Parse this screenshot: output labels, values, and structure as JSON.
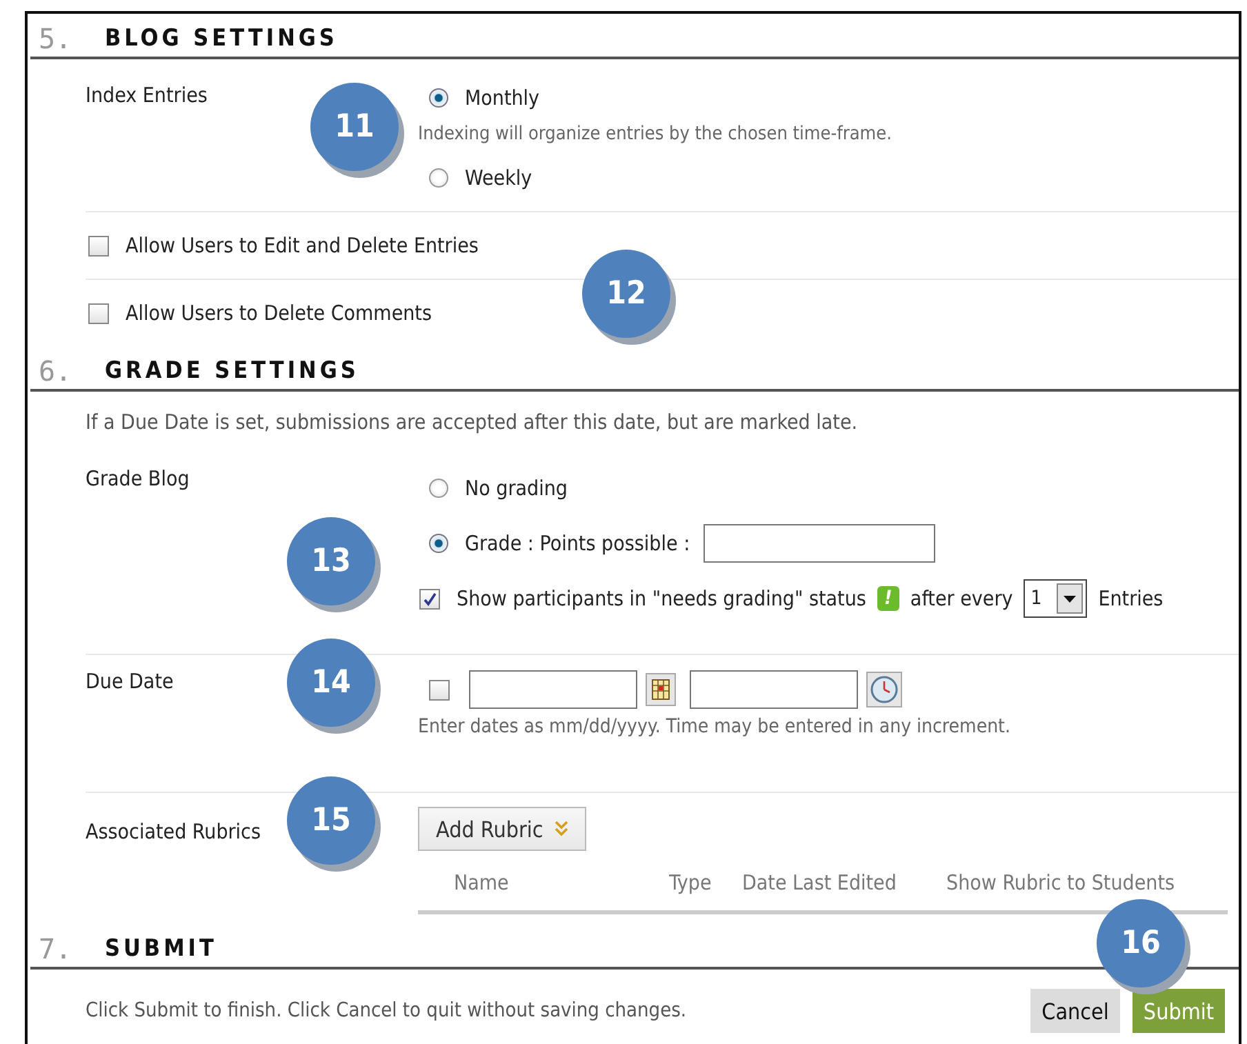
{
  "blog_settings": {
    "number": "5.",
    "title": "BLOG SETTINGS",
    "index_entries": {
      "label": "Index Entries",
      "hint": "Indexing will organize entries by the chosen time-frame.",
      "options": [
        {
          "label": "Monthly",
          "selected": true
        },
        {
          "label": "Weekly",
          "selected": false
        }
      ]
    },
    "checkboxes": [
      {
        "label": "Allow Users to Edit and Delete Entries",
        "checked": false
      },
      {
        "label": "Allow Users to Delete Comments",
        "checked": false
      }
    ]
  },
  "grade_settings": {
    "number": "6.",
    "title": "GRADE SETTINGS",
    "note": "If a Due Date is set, submissions are accepted after this date, but are marked late.",
    "grade_blog": {
      "label": "Grade Blog",
      "options": [
        {
          "label": "No grading",
          "selected": false,
          "kind": "plain"
        },
        {
          "label": "Grade : Points possible :",
          "selected": true,
          "kind": "points"
        }
      ],
      "needs_grading": {
        "checked": true,
        "label": "Show participants in \"needs grading\" status",
        "status_badge": "!",
        "after": "after every",
        "count": "1",
        "end": "Entries"
      }
    },
    "due_date": {
      "label": "Due Date",
      "checked": false,
      "hint": "Enter dates as mm/dd/yyyy. Time may be entered in any increment."
    },
    "rubrics": {
      "label": "Associated Rubrics",
      "button": "Add Rubric",
      "columns": [
        "Name",
        "Type",
        "Date Last Edited",
        "Show Rubric to Students"
      ]
    }
  },
  "submit": {
    "number": "7.",
    "title": "SUBMIT",
    "instruction": "Click Submit to finish. Click Cancel to quit without saving changes.",
    "buttons": [
      {
        "label": "Cancel",
        "kind": "cancel"
      },
      {
        "label": "Submit",
        "kind": "submit"
      }
    ]
  },
  "callouts": [
    {
      "label": "11"
    },
    {
      "label": "12"
    },
    {
      "label": "13"
    },
    {
      "label": "14"
    },
    {
      "label": "15"
    },
    {
      "label": "16"
    }
  ]
}
